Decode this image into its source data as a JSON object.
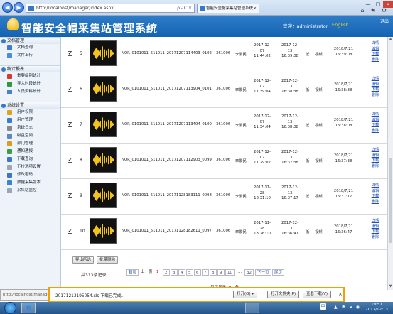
{
  "browser": {
    "back": "◀",
    "forward": "▶",
    "url": "http://localhost/manager/index.aspx",
    "url_tools": "ρ - C ×",
    "tab_title": "智能安全帽采集站管理系统",
    "tab_close": "×",
    "minimize": "—",
    "maximize": "□",
    "close": "×",
    "icons": "⌂ ★ ⚙"
  },
  "header": {
    "title": "智能安全帽采集站管理系统",
    "welcome": "欢迎：administrator",
    "lang": "English",
    "exit": "退出"
  },
  "sidebar": {
    "groups": [
      {
        "label": "文档管理",
        "items": [
          {
            "label": "文档查询",
            "color": "#3b7bd0"
          },
          {
            "label": "文件上传",
            "color": "#4a8de0"
          }
        ]
      },
      {
        "label": "统计报表",
        "items": [
          {
            "label": "重要级别统计",
            "color": "#d43b2f"
          },
          {
            "label": "导入时段统计",
            "color": "#2e9a3e"
          },
          {
            "label": "人员资料统计",
            "color": "#4a7fc9"
          }
        ]
      },
      {
        "label": "系统设置",
        "items": [
          {
            "label": "用户权限",
            "color": "#e0a020"
          },
          {
            "label": "用户管理",
            "color": "#3b7bd0"
          },
          {
            "label": "系统日志",
            "color": "#8a8a8a"
          },
          {
            "label": "磁盘空间",
            "color": "#5b8ac0"
          },
          {
            "label": "部门管理",
            "color": "#e09b20"
          },
          {
            "label": "通知通报",
            "color": "#3e9b47"
          },
          {
            "label": "下载查询",
            "color": "#3a78c6"
          },
          {
            "label": "下拉选项设置",
            "color": "#9aa6b5"
          },
          {
            "label": "修改密码",
            "color": "#3f76c2"
          },
          {
            "label": "数据采集版本",
            "color": "#3a85d0"
          },
          {
            "label": "采集站监控",
            "color": "#9aa6b5"
          }
        ]
      }
    ]
  },
  "rows": [
    {
      "check": "✔",
      "num": "5",
      "file": "NOR_0101011_511011_20171207114403_0102",
      "code": "361006",
      "user": "李爱民",
      "rec_date": "2017-12-",
      "rec_day": "07",
      "rec_time": "11:44:02",
      "imp_date": "2017-12-",
      "imp_day": "13",
      "imp_time": "16:39:08",
      "level": "低",
      "type": "视频",
      "upload_date": "2018/7/21",
      "upload_time": "16:39:08",
      "a1": "详情",
      "a2": "编辑",
      "a3": "下载",
      "a4": "删除"
    },
    {
      "check": "✔",
      "num": "6",
      "file": "NOR_0101011_511011_20171207113904_0101",
      "code": "361006",
      "user": "李爱民",
      "rec_date": "2017-12-",
      "rec_day": "07",
      "rec_time": "11:39:04",
      "imp_date": "2017-12-",
      "imp_day": "13",
      "imp_time": "16:38:38",
      "level": "低",
      "type": "视频",
      "upload_date": "2018/7/21",
      "upload_time": "16:38:38",
      "a1": "详情",
      "a2": "编辑",
      "a3": "下载",
      "a4": "删除"
    },
    {
      "check": "✔",
      "num": "7",
      "file": "NOR_0101011_511011_20171207113404_0100",
      "code": "361006",
      "user": "李爱民",
      "rec_date": "2017-12-",
      "rec_day": "07",
      "rec_time": "11:34:04",
      "imp_date": "2017-12-",
      "imp_day": "13",
      "imp_time": "16:38:08",
      "level": "低",
      "type": "视频",
      "upload_date": "2018/7/21",
      "upload_time": "16:38:08",
      "a1": "详情",
      "a2": "编辑",
      "a3": "下载",
      "a4": "删除"
    },
    {
      "check": "✔",
      "num": "8",
      "file": "NOR_0101011_511011_20171207112903_0099",
      "code": "361006",
      "user": "李爱民",
      "rec_date": "2017-12-",
      "rec_day": "07",
      "rec_time": "11:29:02",
      "imp_date": "2017-12-",
      "imp_day": "13",
      "imp_time": "16:37:38",
      "level": "低",
      "type": "视频",
      "upload_date": "2018/7/21",
      "upload_time": "16:37:38",
      "a1": "详情",
      "a2": "编辑",
      "a3": "下载",
      "a4": "删除"
    },
    {
      "check": "✔",
      "num": "9",
      "file": "NOR_0101011_511011_20171128183111_0098",
      "code": "361006",
      "user": "李爱民",
      "rec_date": "2017-11-",
      "rec_day": "28",
      "rec_time": "18:31:10",
      "imp_date": "2017-12-",
      "imp_day": "13",
      "imp_time": "16:37:17",
      "level": "低",
      "type": "视频",
      "upload_date": "2018/7/21",
      "upload_time": "16:37:17",
      "a1": "详情",
      "a2": "编辑",
      "a3": "下载",
      "a4": "删除"
    },
    {
      "check": "✔",
      "num": "10",
      "file": "NOR_0101011_511011_20171128182611_0097",
      "code": "361006",
      "user": "李爱民",
      "rec_date": "2017-11-",
      "rec_day": "28",
      "rec_time": "18:26:10",
      "imp_date": "2017-12-",
      "imp_day": "13",
      "imp_time": "16:36:47",
      "level": "低",
      "type": "视频",
      "upload_date": "2018/7/21",
      "upload_time": "16:36:47",
      "a1": "详情",
      "a2": "编辑",
      "a3": "下载",
      "a4": "删除"
    }
  ],
  "actions": {
    "export": "导出所选",
    "batch_delete": "批量删除"
  },
  "pager": {
    "total": "共313条记录",
    "first": "首页",
    "prev": "上一页",
    "pages": [
      "1",
      "2",
      "3",
      "4",
      "5",
      "6",
      "7",
      "8",
      "9",
      "10"
    ],
    "ellipsis": "...",
    "last_num": "32",
    "next": "下一页",
    "last": "尾页",
    "per_page": "每页显示10　条"
  },
  "status_url": "http://localhost/manager/...",
  "download": {
    "message": "20171213195054.xls 下载已完成。",
    "open": "打开(O)",
    "open_menu": "▾",
    "open_folder": "打开文件夹(P)",
    "view_downloads": "查看下载(V)",
    "close": "×"
  },
  "taskbar": {
    "ie_glyph": "e",
    "lang": "中",
    "tray": "▲ ⚑ ◂ ◉",
    "time": "19:57",
    "date": "2017/12/13"
  }
}
